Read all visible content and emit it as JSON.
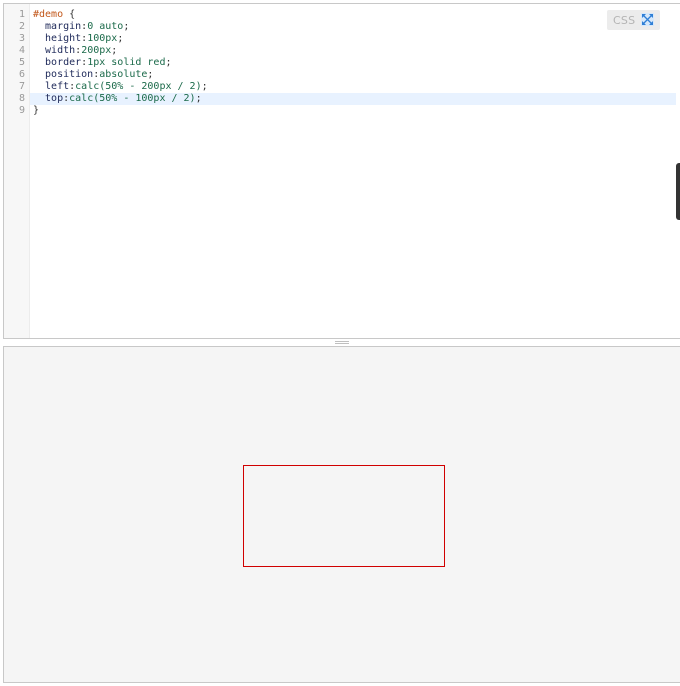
{
  "editor": {
    "language_label": "CSS",
    "lines": [
      {
        "num": "1",
        "tokens": [
          {
            "t": "#demo",
            "c": "selector"
          },
          {
            "t": " {",
            "c": "punct"
          }
        ]
      },
      {
        "num": "2",
        "tokens": [
          {
            "t": "  margin",
            "c": "prop"
          },
          {
            "t": ":",
            "c": "punct"
          },
          {
            "t": "0 auto",
            "c": "val"
          },
          {
            "t": ";",
            "c": "punct"
          }
        ]
      },
      {
        "num": "3",
        "tokens": [
          {
            "t": "  height",
            "c": "prop"
          },
          {
            "t": ":",
            "c": "punct"
          },
          {
            "t": "100px",
            "c": "val"
          },
          {
            "t": ";",
            "c": "punct"
          }
        ]
      },
      {
        "num": "4",
        "tokens": [
          {
            "t": "  width",
            "c": "prop"
          },
          {
            "t": ":",
            "c": "punct"
          },
          {
            "t": "200px",
            "c": "val"
          },
          {
            "t": ";",
            "c": "punct"
          }
        ]
      },
      {
        "num": "5",
        "tokens": [
          {
            "t": "  border",
            "c": "prop"
          },
          {
            "t": ":",
            "c": "punct"
          },
          {
            "t": "1px solid red",
            "c": "val"
          },
          {
            "t": ";",
            "c": "punct"
          }
        ]
      },
      {
        "num": "6",
        "tokens": [
          {
            "t": "  position",
            "c": "prop"
          },
          {
            "t": ":",
            "c": "punct"
          },
          {
            "t": "absolute",
            "c": "val"
          },
          {
            "t": ";",
            "c": "punct"
          }
        ]
      },
      {
        "num": "7",
        "tokens": [
          {
            "t": "  left",
            "c": "prop"
          },
          {
            "t": ":",
            "c": "punct"
          },
          {
            "t": "calc(50% - 200px / 2)",
            "c": "val"
          },
          {
            "t": ";",
            "c": "punct"
          }
        ]
      },
      {
        "num": "8",
        "tokens": [
          {
            "t": "  top",
            "c": "prop"
          },
          {
            "t": ":",
            "c": "punct"
          },
          {
            "t": "calc(50% - 100px / 2)",
            "c": "val"
          },
          {
            "t": ";",
            "c": "punct"
          }
        ]
      },
      {
        "num": "9",
        "tokens": [
          {
            "t": "}",
            "c": "punct"
          }
        ]
      }
    ],
    "active_line": "8",
    "icons": {
      "expand": "expand-arrows-icon"
    }
  },
  "preview": {
    "demo_box_border_color": "#d00000"
  },
  "colors": {
    "selector": "#c2571a",
    "property": "#1f2a5a",
    "value": "#1b6a4a",
    "active_line": "#e8f2ff"
  }
}
